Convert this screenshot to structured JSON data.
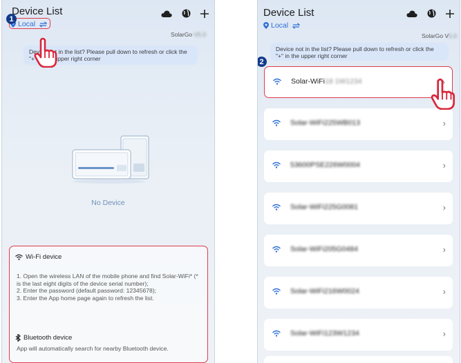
{
  "panel1": {
    "step": "1",
    "title": "Device List",
    "location": "Local",
    "solargo": "SolarGo",
    "banner": "Device not in the list? Please pull down to refresh or click the \"+\" in the upper right corner",
    "empty_text": "No Device",
    "wifi_section": {
      "title": "Wi-Fi device",
      "text": "1. Open the wireless LAN of the mobile phone and find Solar-WiFi* (* is the last eight digits of the device serial number);\n2. Enter the password (default password: 12345678);\n3. Enter the App home page again to refresh the list."
    },
    "bt_section": {
      "title": "Bluetooth device",
      "text": "App will automatically search for nearby Bluetooth device."
    }
  },
  "panel2": {
    "step": "2",
    "title": "Device List",
    "location": "Local",
    "solargo": "SolarGo V",
    "banner": "Device not in the list? Please pull down to refresh or click the \"+\" in the upper right corner",
    "devices": [
      {
        "name": "Solar-WiFi",
        "suffix": "18 1W1234"
      },
      {
        "name": "Solar-WiFi225WB013",
        "suffix": ""
      },
      {
        "name": "53600PSE226W0004",
        "suffix": ""
      },
      {
        "name": "Solar-WiFi225G0081",
        "suffix": ""
      },
      {
        "name": "Solar-WiFi205G0484",
        "suffix": ""
      },
      {
        "name": "Solar-WiFi216W0024",
        "suffix": ""
      },
      {
        "name": "Solar-WiFi123W1234",
        "suffix": ""
      }
    ]
  },
  "icons": [
    "cloud-icon",
    "globe-icon",
    "plus-icon",
    "location-pin-icon",
    "switch-icon",
    "wifi-icon",
    "bluetooth-icon",
    "chevron-right-icon",
    "tap-hand-icon"
  ],
  "colors": {
    "accent": "#2f6fd6",
    "highlight": "#e03a4a",
    "badge": "#123a8a",
    "banner": "#d9e6fa"
  }
}
